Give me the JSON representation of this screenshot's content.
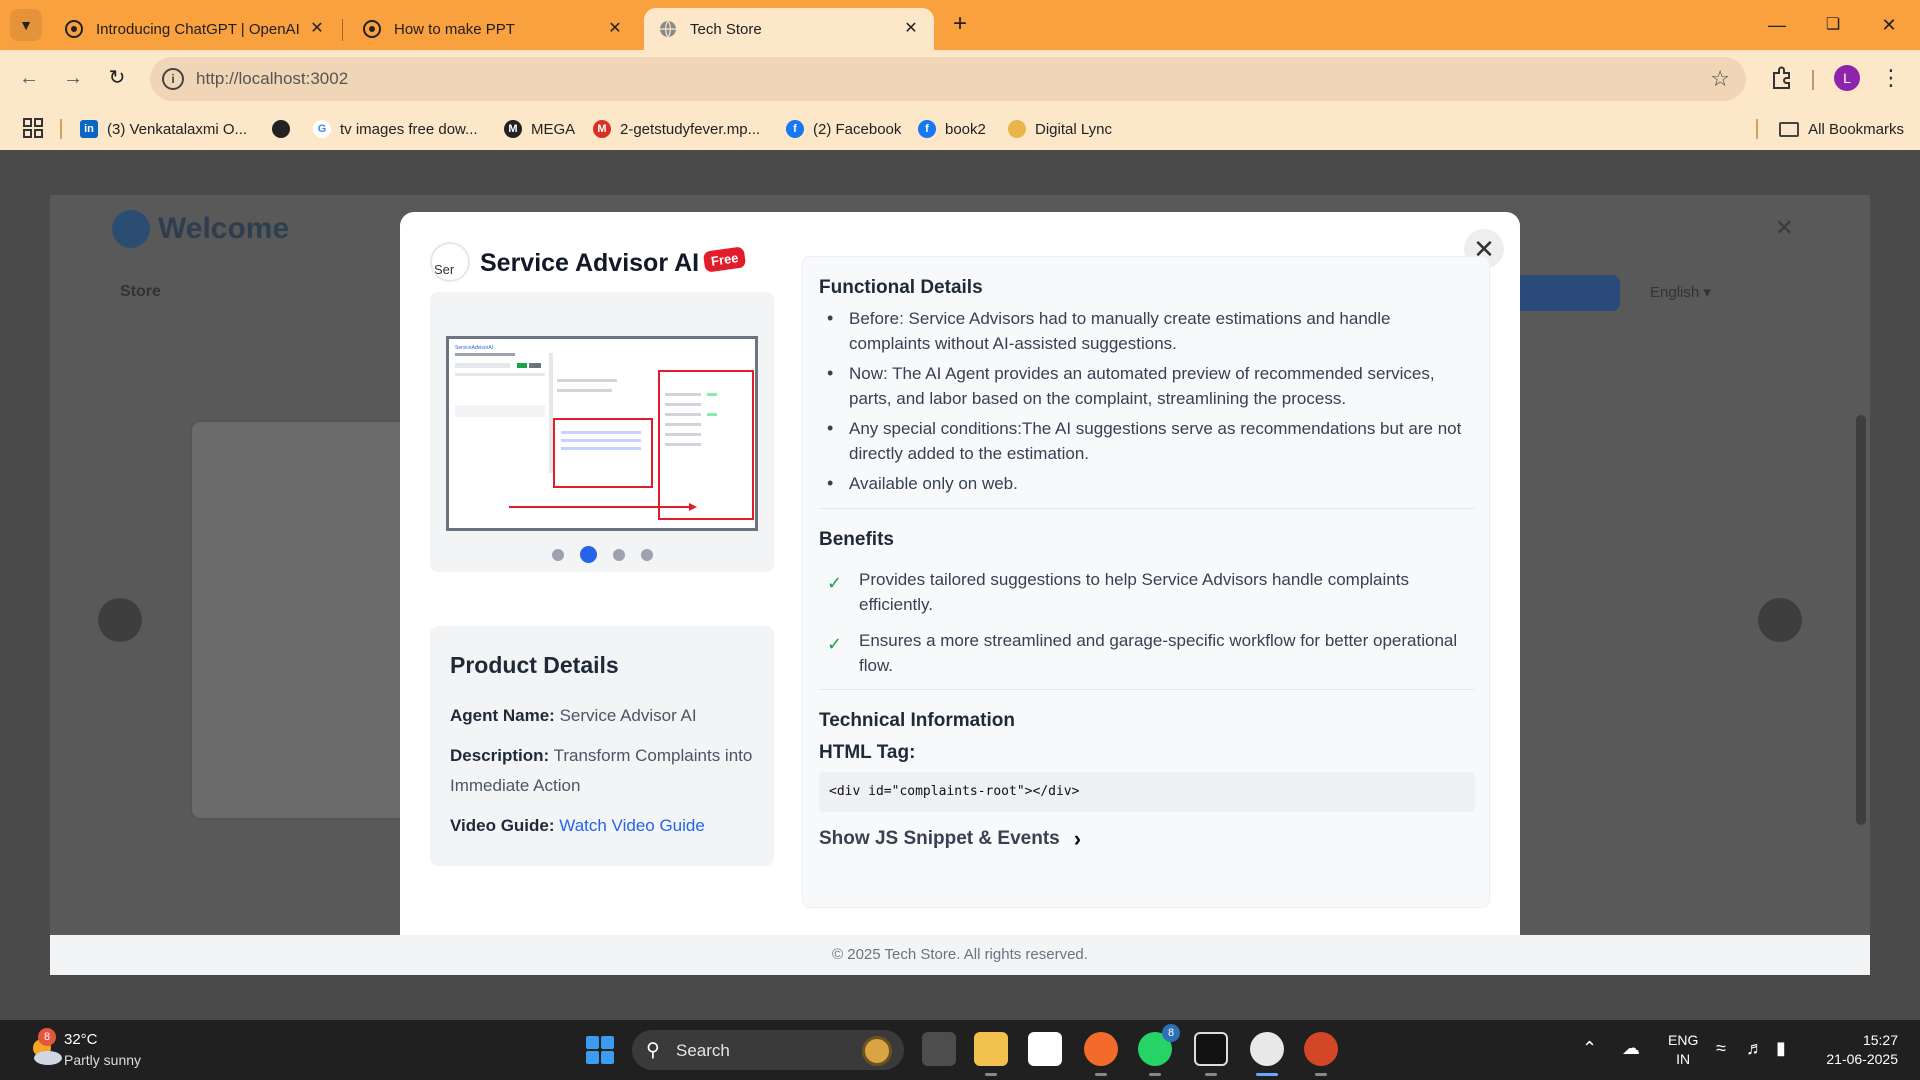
{
  "browser": {
    "tabs": [
      {
        "title": "Introducing ChatGPT | OpenAI",
        "icon": "openai-icon"
      },
      {
        "title": "How to make PPT",
        "icon": "openai-icon"
      },
      {
        "title": "Tech Store",
        "icon": "globe-icon",
        "active": true
      }
    ],
    "url": "http://localhost:3002",
    "profile_initial": "L",
    "bookmarks": [
      {
        "label": "(3) Venkatalaxmi O...",
        "icon": "linkedin-icon"
      },
      {
        "label": "",
        "icon": "globe-icon"
      },
      {
        "label": "tv images free dow...",
        "icon": "google-icon"
      },
      {
        "label": "MEGA",
        "icon": "mega-icon"
      },
      {
        "label": "2-getstudyfever.mp...",
        "icon": "gmail-icon"
      },
      {
        "label": "(2) Facebook",
        "icon": "facebook-icon"
      },
      {
        "label": "book2",
        "icon": "facebook-icon"
      },
      {
        "label": "Digital Lync",
        "icon": "digital-lync-icon"
      }
    ],
    "all_bookmarks": "All Bookmarks"
  },
  "page": {
    "welcome": "Welcome",
    "footer": "© 2025 Tech Store. All rights reserved."
  },
  "modal": {
    "title": "Service Advisor AI",
    "badge": "Free",
    "logo_alt": "Ser",
    "carousel": {
      "dots": 4,
      "active_index": 1
    },
    "product_details": {
      "heading": "Product Details",
      "agent_name_label": "Agent Name:",
      "agent_name": "Service Advisor AI",
      "description_label": "Description:",
      "description": "Transform Complaints into Immediate Action",
      "video_label": "Video Guide:",
      "video_link": "Watch Video Guide"
    },
    "functional": {
      "heading": "Functional Details",
      "items": [
        "Before: Service Advisors had to manually create estimations and handle complaints without AI-assisted suggestions.",
        "Now: The AI Agent provides an automated preview of recommended services, parts, and labor based on the complaint, streamlining the process.",
        "Any special conditions:The AI suggestions serve as recommendations but are not directly added to the estimation.",
        "Available only on web."
      ]
    },
    "benefits": {
      "heading": "Benefits",
      "items": [
        "Provides tailored suggestions to help Service Advisors handle complaints efficiently.",
        "Ensures a more streamlined and garage-specific workflow for better operational flow."
      ]
    },
    "technical": {
      "heading": "Technical Information",
      "html_tag_label": "HTML Tag:",
      "html_tag": "<div id=\"complaints-root\"></div>",
      "js_toggle": "Show JS Snippet & Events"
    }
  },
  "taskbar": {
    "weather_badge": "8",
    "temperature": "32°C",
    "weather": "Partly sunny",
    "search": "Search",
    "whatsapp_badge": "8",
    "lang_top": "ENG",
    "lang_bottom": "IN",
    "time": "15:27",
    "date": "21-06-2025"
  },
  "colors": {
    "tabstrip": "#f9a03f",
    "toolbar": "#fde7c9",
    "accent": "#2563eb",
    "free_badge": "#e11d2a",
    "check": "#16a34a"
  }
}
